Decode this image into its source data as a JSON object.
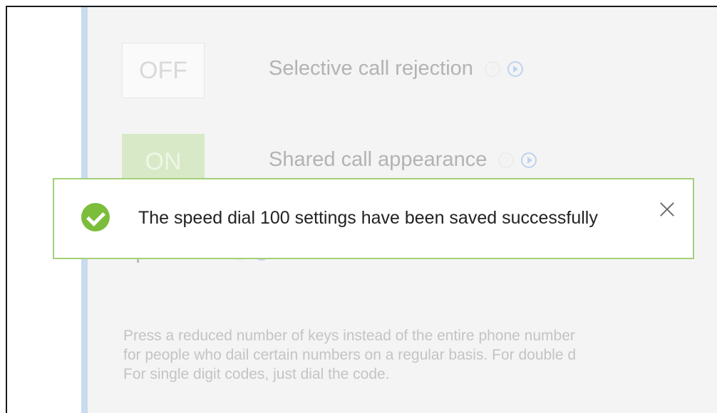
{
  "features": [
    {
      "toggle": "OFF",
      "label": "Selective call rejection",
      "help_glyph": "?",
      "icon": "play-icon"
    },
    {
      "toggle": "ON",
      "label": "Shared call appearance",
      "help_glyph": "?",
      "icon": "play-icon"
    },
    {
      "label": "Speed dial",
      "help_glyph": "?",
      "icon": "play-icon"
    }
  ],
  "description": [
    "Press a reduced number of keys instead of the entire phone number",
    "for people who dail certain numbers on a regular basis. For double d",
    "For single digit codes, just dial the code."
  ],
  "toast": {
    "message": "The speed dial 100 settings have been saved successfully",
    "icon": "check-circle-icon",
    "close_icon": "close-icon"
  },
  "colors": {
    "accent_bar": "#c8dbef",
    "toast_border": "#a6cf7a",
    "success_green": "#7cbd3c",
    "on_toggle": "#d7e9c6"
  }
}
